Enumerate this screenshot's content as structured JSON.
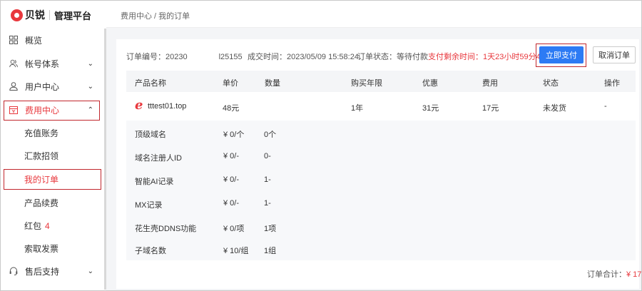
{
  "brand": {
    "name": "贝锐",
    "subtitle": "管理平台"
  },
  "sidebar": {
    "items": [
      {
        "label": "概览",
        "icon": "grid-icon"
      },
      {
        "label": "帐号体系",
        "icon": "users-icon",
        "chevron": "⌄"
      },
      {
        "label": "用户中心",
        "icon": "user-icon",
        "chevron": "⌄"
      },
      {
        "label": "费用中心",
        "icon": "wallet-icon",
        "chevron": "⌃"
      },
      {
        "label": "充值账务"
      },
      {
        "label": "汇款招领"
      },
      {
        "label": "我的订单"
      },
      {
        "label": "产品续费"
      },
      {
        "label": "红包",
        "badge": "4"
      },
      {
        "label": "索取发票"
      },
      {
        "label": "售后支持",
        "icon": "headset-icon",
        "chevron": "⌄"
      }
    ]
  },
  "header": {
    "breadcrumb": "费用中心 / 我的订单"
  },
  "order": {
    "number": "订单编号：20230        l25155",
    "time": "成交时间：2023/05/09 15:58:24",
    "status": "订单状态：等待付款",
    "countdown": "支付剩余时间：1天23小时59分46秒",
    "pay_button": "立即支付",
    "cancel_button": "取消订单"
  },
  "table": {
    "headers": [
      "产品名称",
      "单价",
      "数量",
      "购买年限",
      "优惠",
      "费用",
      "状态",
      "操作"
    ],
    "product": {
      "name": "tttest01.top",
      "price": "48元",
      "qty": "",
      "years": "1年",
      "discount": "31元",
      "cost": "17元",
      "status": "未发货",
      "action": "-"
    },
    "rows": [
      {
        "name": "顶级域名",
        "price": "¥ 0/个",
        "qty": "0个"
      },
      {
        "name": "域名注册人ID",
        "price": "¥ 0/-",
        "qty": "0-"
      },
      {
        "name": "智能AI记录",
        "price": "¥ 0/-",
        "qty": "1-"
      },
      {
        "name": "MX记录",
        "price": "¥ 0/-",
        "qty": "1-"
      },
      {
        "name": "花生壳DDNS功能",
        "price": "¥ 0/项",
        "qty": "1项"
      },
      {
        "name": "子域名数",
        "price": "¥ 10/组",
        "qty": "1组"
      }
    ]
  },
  "total": {
    "label": "订单合计：",
    "value": "¥ 17"
  },
  "colors": {
    "accent": "#2d7bf4",
    "brand": "#e8383d",
    "highlight_box": "#c1272d"
  }
}
